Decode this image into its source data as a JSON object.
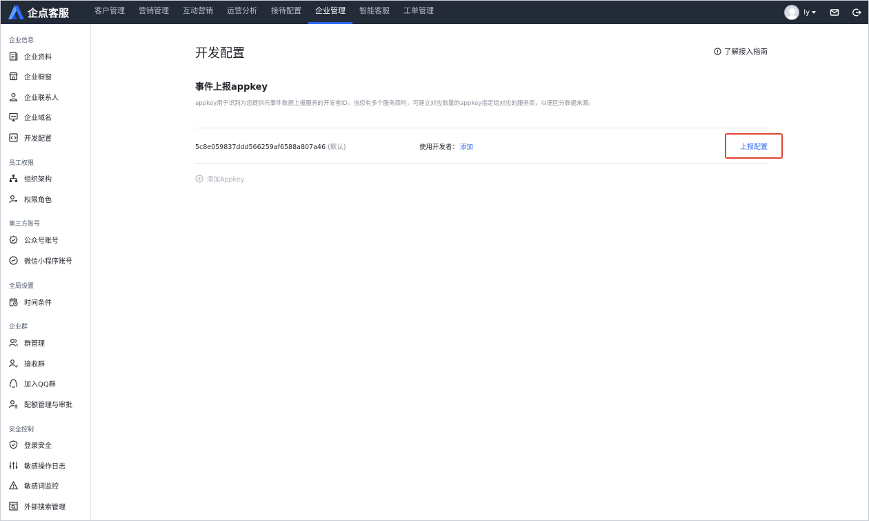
{
  "brand": {
    "name": "企点客服"
  },
  "nav": [
    {
      "label": "客户管理"
    },
    {
      "label": "营销管理"
    },
    {
      "label": "互动营销"
    },
    {
      "label": "运营分析"
    },
    {
      "label": "接待配置"
    },
    {
      "label": "企业管理",
      "active": true
    },
    {
      "label": "智能客服"
    },
    {
      "label": "工单管理"
    }
  ],
  "user": {
    "name": "ly"
  },
  "sidebar": {
    "groups": [
      {
        "title": "企业信息",
        "items": [
          {
            "label": "企业资料",
            "icon": "document-icon"
          },
          {
            "label": "企业橱窗",
            "icon": "storefront-icon"
          },
          {
            "label": "企业联系人",
            "icon": "contact-icon"
          },
          {
            "label": "企业域名",
            "icon": "monitor-icon"
          },
          {
            "label": "开发配置",
            "icon": "code-icon"
          }
        ]
      },
      {
        "title": "员工权限",
        "items": [
          {
            "label": "组织架构",
            "icon": "org-chart-icon"
          },
          {
            "label": "权限角色",
            "icon": "user-role-icon"
          }
        ]
      },
      {
        "title": "第三方账号",
        "items": [
          {
            "label": "公众号账号",
            "icon": "official-account-icon"
          },
          {
            "label": "微信小程序账号",
            "icon": "mini-program-icon"
          }
        ]
      },
      {
        "title": "全局设置",
        "items": [
          {
            "label": "时间条件",
            "icon": "calendar-clock-icon"
          }
        ]
      },
      {
        "title": "企业群",
        "items": [
          {
            "label": "群管理",
            "icon": "group-icon"
          },
          {
            "label": "接收群",
            "icon": "group-receive-icon"
          },
          {
            "label": "加入QQ群",
            "icon": "qq-group-icon"
          },
          {
            "label": "配额管理与审批",
            "icon": "quota-approval-icon"
          }
        ]
      },
      {
        "title": "安全控制",
        "items": [
          {
            "label": "登录安全",
            "icon": "shield-icon"
          },
          {
            "label": "敏感操作日志",
            "icon": "sliders-icon"
          },
          {
            "label": "敏感词监控",
            "icon": "warning-icon"
          },
          {
            "label": "外部搜索管理",
            "icon": "search-box-icon"
          }
        ]
      }
    ]
  },
  "page": {
    "title": "开发配置",
    "guide_link": "了解接入指南",
    "section_title": "事件上报appkey",
    "description": "appkey用于识别为您提供元事件数据上报服务的开发者ID，当您有多个服务商时，可建立对应数量的appkey指定给对应的服务商，以便区分数据来源。",
    "appkey": {
      "value": "5c8e059837ddd566259af6588a807a46",
      "default_tag": "(默认)",
      "developer_label": "使用开发者：",
      "developer_add": "添加",
      "report_button": "上报配置"
    },
    "add_appkey": "添加Appkey"
  },
  "colors": {
    "topbar": "#232a38",
    "accent": "#2f6bf5",
    "highlight_border": "#e2442e"
  }
}
